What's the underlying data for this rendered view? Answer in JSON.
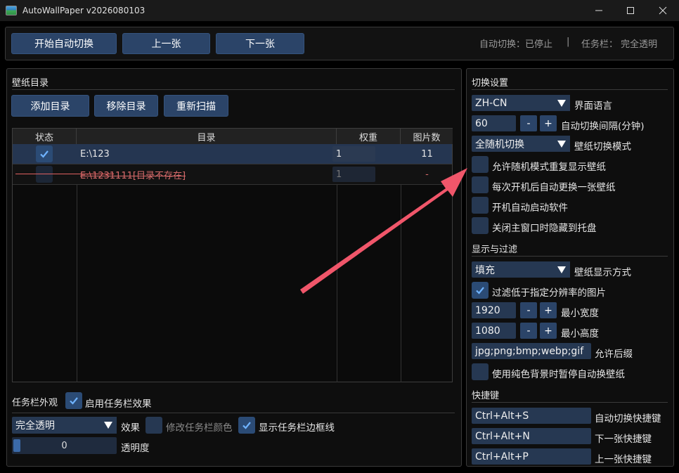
{
  "window": {
    "title": "AutoWallPaper v2026080103",
    "minimize_icon": "minimize-icon",
    "maximize_icon": "maximize-icon",
    "close_icon": "close-icon"
  },
  "toolbar": {
    "start_label": "开始自动切换",
    "prev_label": "上一张",
    "next_label": "下一张",
    "status_auto": "自动切换：已停止",
    "separator": "|",
    "status_taskbar": "任务栏：  完全透明"
  },
  "wallpaper_dirs": {
    "title": "壁纸目录",
    "add_label": "添加目录",
    "remove_label": "移除目录",
    "rescan_label": "重新扫描",
    "columns": [
      "状态",
      "目录",
      "权重",
      "图片数"
    ],
    "rows": [
      {
        "enabled": true,
        "path": "E:\\123",
        "weight": "1",
        "count": "11",
        "valid": true
      },
      {
        "enabled": false,
        "path": "E:\\1231111[目录不存在]",
        "weight": "1",
        "count": "-",
        "valid": false
      }
    ]
  },
  "taskbar": {
    "title": "任务栏外观",
    "enable_label": "启用任务栏效果",
    "enable_checked": true,
    "effect_value": "完全透明",
    "effect_label": "效果",
    "modify_color_label": "修改任务栏颜色",
    "modify_color_checked": false,
    "show_border_label": "显示任务栏边框线",
    "show_border_checked": true,
    "opacity_value": "0",
    "opacity_fraction": 0.0,
    "opacity_label": "透明度"
  },
  "switch_settings": {
    "title": "切换设置",
    "language_value": "ZH-CN",
    "language_label": "界面语言",
    "interval_value": "60",
    "interval_minus": "-",
    "interval_plus": "+",
    "interval_label": "自动切换间隔(分钟)",
    "mode_value": "全随机切换",
    "mode_label": "壁纸切换模式",
    "options": [
      {
        "label": "允许随机模式重复显示壁纸",
        "checked": false
      },
      {
        "label": "每次开机后自动更换一张壁纸",
        "checked": false
      },
      {
        "label": "开机自动启动软件",
        "checked": false
      },
      {
        "label": "关闭主窗口时隐藏到托盘",
        "checked": false
      }
    ]
  },
  "display_filter": {
    "title": "显示与过滤",
    "fit_value": "填充",
    "fit_label": "壁纸显示方式",
    "filter_label": "过滤低于指定分辨率的图片",
    "filter_checked": true,
    "min_width_value": "1920",
    "min_width_label": "最小宽度",
    "min_height_value": "1080",
    "min_height_label": "最小高度",
    "minus": "-",
    "plus": "+",
    "ext_value": "jpg;png;bmp;webp;gif",
    "ext_label": "允许后缀",
    "pause_label": "使用纯色背景时暂停自动换壁纸",
    "pause_checked": false
  },
  "hotkeys": {
    "title": "快捷键",
    "items": [
      {
        "value": "Ctrl+Alt+S",
        "label": "自动切换快捷键"
      },
      {
        "value": "Ctrl+Alt+N",
        "label": "下一张快捷键"
      },
      {
        "value": "Ctrl+Alt+P",
        "label": "上一张快捷键"
      }
    ]
  },
  "colors": {
    "accent": "#2b4468",
    "arrow": "#f0566a",
    "invalid_text": "#e06060"
  }
}
